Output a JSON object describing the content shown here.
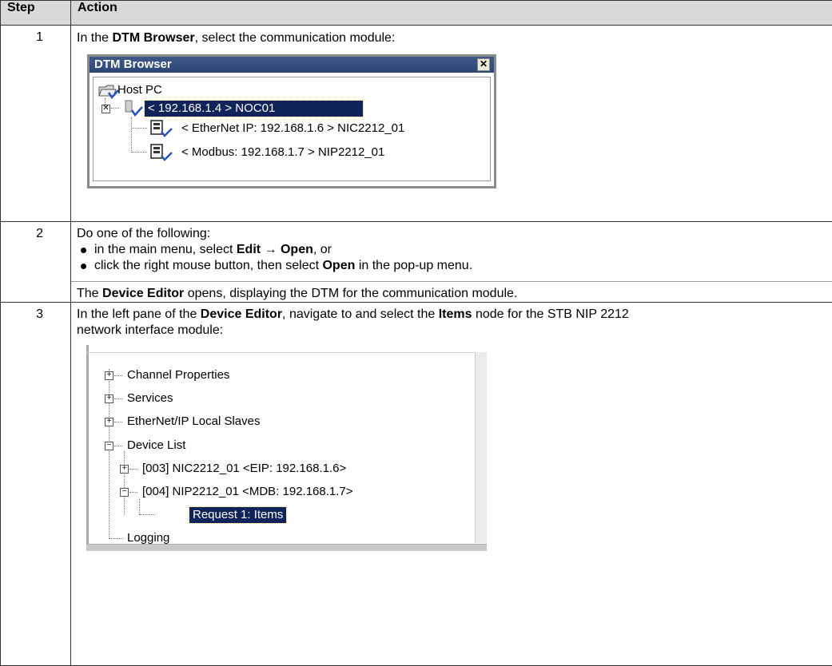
{
  "headers": {
    "step": "Step",
    "action": "Action"
  },
  "rows": [
    {
      "step": "1",
      "intro": {
        "pre": "In the ",
        "bold": "DTM Browser",
        "post": ", select the communication module:"
      },
      "dtm": {
        "title": "DTM Browser",
        "close": "✕",
        "host": "Host PC",
        "noc": "< 192.168.1.4 > NOC01",
        "child1": "< EtherNet IP: 192.168.1.6 > NIC2212_01",
        "child2": "< Modbus: 192.168.1.7 > NIP2212_01"
      }
    },
    {
      "step": "2",
      "intro": "Do one of the following:",
      "bullet1": {
        "pre": "in the main menu, select ",
        "bold1": "Edit",
        "arrow": " → ",
        "bold2": "Open",
        "post": ", or"
      },
      "bullet2": {
        "pre": "click the right mouse button, then select ",
        "bold": "Open",
        "post": " in the pop-up menu."
      },
      "result": {
        "pre": "The ",
        "bold": "Device Editor",
        "post": " opens, displaying the DTM for the communication module."
      }
    },
    {
      "step": "3",
      "intro": {
        "pre": "In the left pane of the ",
        "bold1": "Device Editor",
        "mid": ", navigate to and select the ",
        "bold2": "Items",
        "post": " node for the STB NIP 2212"
      },
      "intro2": "network interface module:",
      "tree": {
        "channel": "Channel Properties",
        "services": "Services",
        "eip_slaves": "EtherNet/IP Local Slaves",
        "device_list": "Device List",
        "nic": "[003] NIC2212_01 <EIP: 192.168.1.6>",
        "nip": "[004] NIP2212_01 <MDB: 192.168.1.7>",
        "request": "Request 1: Items",
        "logging": "Logging",
        "plus": "+",
        "minus": "−"
      }
    }
  ],
  "colors": {
    "header_bg": "#d9d9d9",
    "selection_bg": "#10245c",
    "titlebar": "#2c4675"
  }
}
